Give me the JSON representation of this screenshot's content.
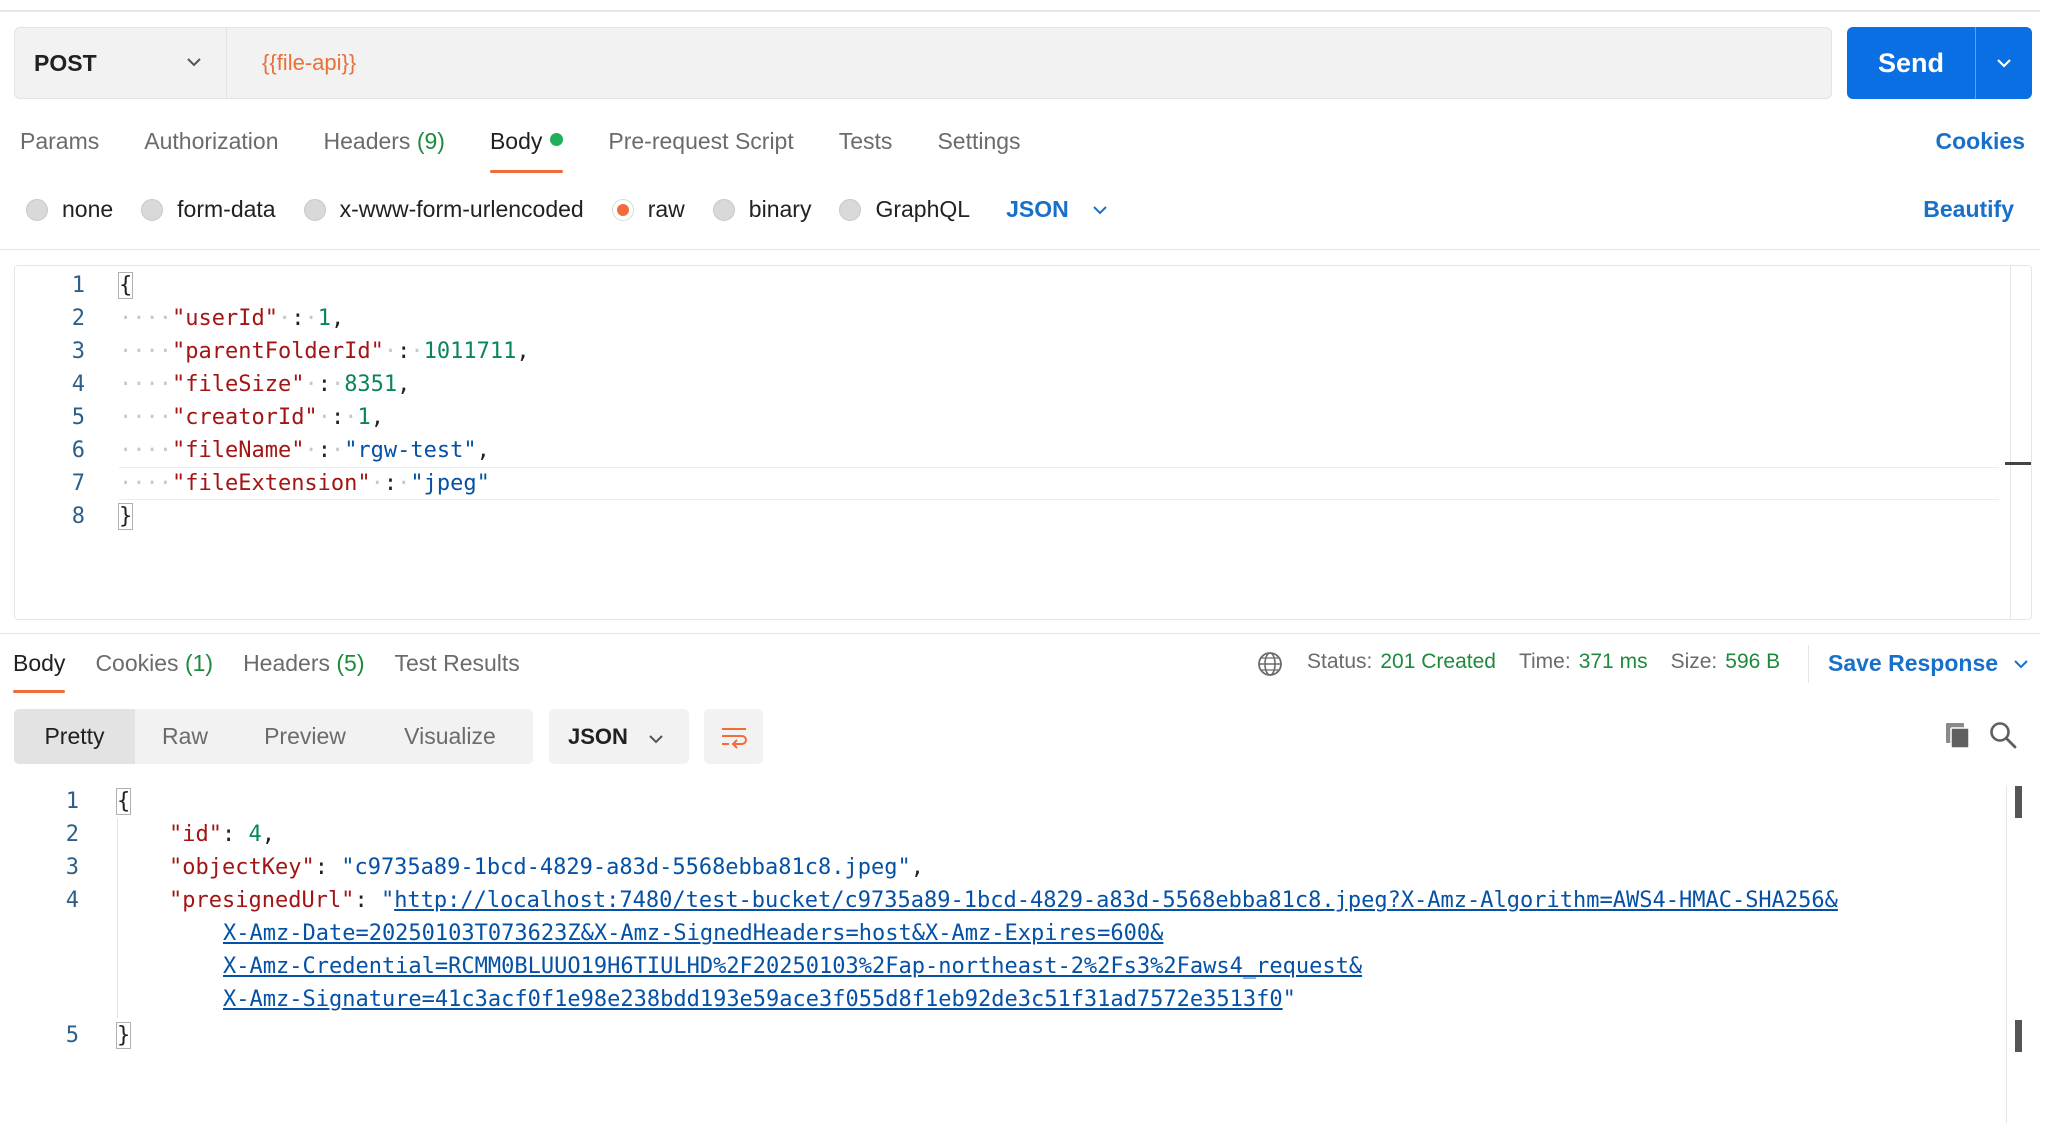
{
  "request": {
    "method": "POST",
    "url": "{{file-api}}",
    "send_label": "Send",
    "tabs": [
      {
        "label": "Params",
        "count": ""
      },
      {
        "label": "Authorization",
        "count": ""
      },
      {
        "label": "Headers",
        "count": "(9)"
      },
      {
        "label": "Body",
        "count": ""
      },
      {
        "label": "Pre-request Script",
        "count": ""
      },
      {
        "label": "Tests",
        "count": ""
      },
      {
        "label": "Settings",
        "count": ""
      }
    ],
    "active_tab": "Body",
    "cookies_label": "Cookies",
    "body_types": [
      "none",
      "form-data",
      "x-www-form-urlencoded",
      "raw",
      "binary",
      "GraphQL"
    ],
    "selected_body_type": "raw",
    "body_language": "JSON",
    "beautify_label": "Beautify",
    "line_numbers": [
      "1",
      "2",
      "3",
      "4",
      "5",
      "6",
      "7",
      "8"
    ],
    "body_lines": [
      {
        "key": "",
        "value": "",
        "open": "{"
      },
      {
        "key": "\"userId\"",
        "value": "1",
        "value_type": "number",
        "comma": ","
      },
      {
        "key": "\"parentFolderId\"",
        "value": "1011711",
        "value_type": "number",
        "comma": ","
      },
      {
        "key": "\"fileSize\"",
        "value": "8351",
        "value_type": "number",
        "comma": ","
      },
      {
        "key": "\"creatorId\"",
        "value": "1",
        "value_type": "number",
        "comma": ","
      },
      {
        "key": "\"fileName\"",
        "value": "\"rgw-test\"",
        "value_type": "string",
        "comma": ","
      },
      {
        "key": "\"fileExtension\"",
        "value": "\"jpeg\"",
        "value_type": "string",
        "comma": ""
      },
      {
        "key": "",
        "value": "",
        "close": "}"
      }
    ]
  },
  "response": {
    "tabs": [
      {
        "label": "Body",
        "count": ""
      },
      {
        "label": "Cookies",
        "count": "(1)"
      },
      {
        "label": "Headers",
        "count": "(5)"
      },
      {
        "label": "Test Results",
        "count": ""
      }
    ],
    "active_tab": "Body",
    "status_label": "Status:",
    "status_value": "201 Created",
    "time_label": "Time:",
    "time_value": "371 ms",
    "size_label": "Size:",
    "size_value": "596 B",
    "save_response_label": "Save Response",
    "view_modes": [
      "Pretty",
      "Raw",
      "Preview",
      "Visualize"
    ],
    "active_view_mode": "Pretty",
    "format": "JSON",
    "line_numbers": [
      "1",
      "2",
      "3",
      "4",
      "5"
    ],
    "body": {
      "open": "{",
      "id_key": "\"id\"",
      "id_value": "4",
      "objectKey_key": "\"objectKey\"",
      "objectKey_value": "\"c9735a89-1bcd-4829-a83d-5568ebba81c8.jpeg\"",
      "presignedUrl_key": "\"presignedUrl\"",
      "presignedUrl_lines": [
        "http://localhost:7480/test-bucket/c9735a89-1bcd-4829-a83d-5568ebba81c8.jpeg?X-Amz-Algorithm=AWS4-HMAC-SHA256&",
        "X-Amz-Date=20250103T073623Z&X-Amz-SignedHeaders=host&X-Amz-Expires=600&",
        "X-Amz-Credential=RCMM0BLUUO19H6TIULHD%2F20250103%2Fap-northeast-2%2Fs3%2Faws4_request&",
        "X-Amz-Signature=41c3acf0f1e98e238bdd193e59ace3f055d8f1eb92de3c51f31ad7572e3513f0"
      ],
      "close": "}"
    }
  },
  "colors": {
    "accent_orange": "#f26b3a",
    "link_blue": "#1870c9",
    "send_blue": "#0a6fe3",
    "success_green": "#1e8a3c"
  }
}
